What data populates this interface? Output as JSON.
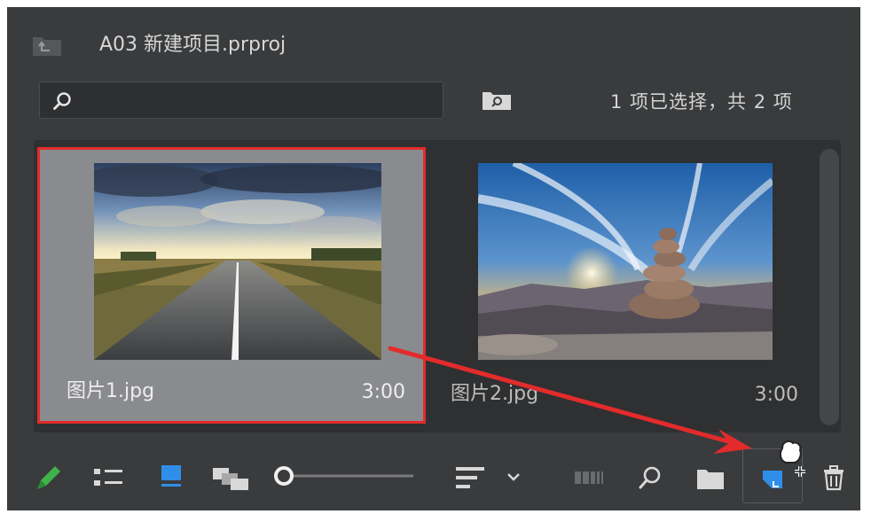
{
  "header": {
    "title": "A03 新建项目.prproj",
    "folder_icon": "folder-up-icon"
  },
  "search": {
    "value": "",
    "placeholder": "",
    "icon": "search-icon",
    "bin_search_icon": "find-in-bin-icon",
    "selection_count": "1 项已选择，共 2 项"
  },
  "items": [
    {
      "name": "图片1.jpg",
      "duration": "3:00",
      "selected": true,
      "thumbnail": "road-landscape-image"
    },
    {
      "name": "图片2.jpg",
      "duration": "3:00",
      "selected": false,
      "thumbnail": "stone-cairn-sunset-image"
    }
  ],
  "toolbar": {
    "icons": [
      "write-protect-pencil-icon",
      "list-view-icon",
      "icon-view-icon",
      "freeform-view-icon",
      "zoom-slider",
      "sort-icons-icon",
      "sort-dropdown-chevron-icon",
      "automate-to-sequence-icon",
      "find-icon",
      "new-bin-icon",
      "new-item-icon",
      "clear-trash-icon"
    ],
    "zoom_level": 0.05
  },
  "colors": {
    "panel_bg": "#3a3b3d",
    "selection_border": "#e32b2b",
    "accent_blue": "#2f8fe8",
    "pencil_green": "#3fb24a"
  }
}
